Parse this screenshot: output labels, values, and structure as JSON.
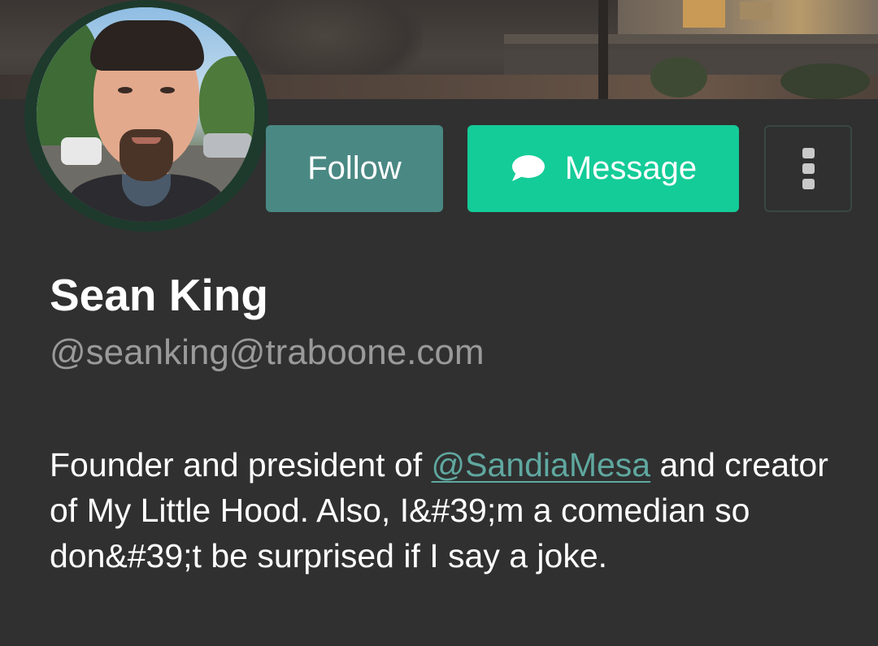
{
  "profile": {
    "display_name": "Sean King",
    "handle": "@seanking@traboone.com",
    "bio": {
      "before_mention": "Founder and president of ",
      "mention": "@SandiaMesa",
      "after_mention": " and creator of My Little Hood. Also, I&#39;m a comedian so don&#39;t be surprised if I say a joke."
    }
  },
  "actions": {
    "follow_label": "Follow",
    "message_label": "Message",
    "message_icon": "speech-bubble-icon",
    "more_icon": "vertical-ellipsis-icon"
  },
  "colors": {
    "background": "#303030",
    "follow_button": "#4a8883",
    "message_button": "#14cc98",
    "mention": "#5fa8a0",
    "handle": "#9a9a9a"
  }
}
